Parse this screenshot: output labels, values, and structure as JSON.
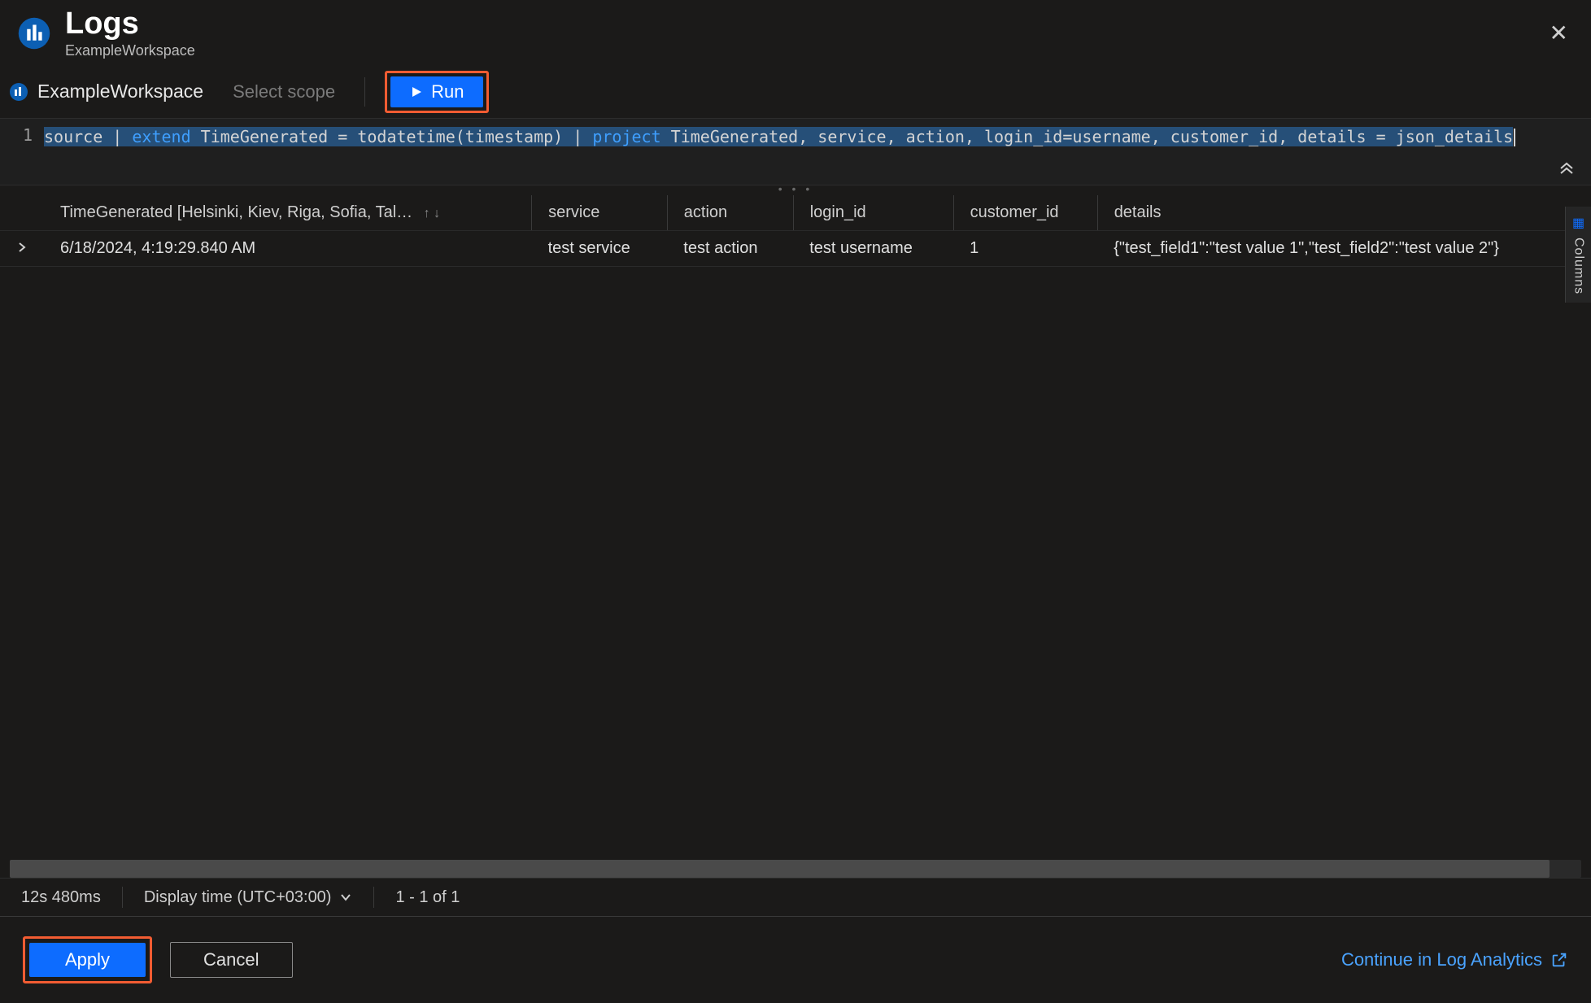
{
  "header": {
    "title": "Logs",
    "subtitle": "ExampleWorkspace"
  },
  "toolbar": {
    "workspace_name": "ExampleWorkspace",
    "select_scope_label": "Select scope",
    "run_label": "Run"
  },
  "editor": {
    "line_number": "1",
    "query_tokens": [
      {
        "t": "source ",
        "c": "tkn",
        "sel": true
      },
      {
        "t": "| ",
        "c": "tkn",
        "sel": true
      },
      {
        "t": "extend",
        "c": "kw",
        "sel": true
      },
      {
        "t": " TimeGenerated = todatetime(timestamp) ",
        "c": "tkn",
        "sel": true
      },
      {
        "t": "| ",
        "c": "tkn",
        "sel": true
      },
      {
        "t": "project",
        "c": "kw",
        "sel": true
      },
      {
        "t": " TimeGenerated, service, action, login_id=username, customer_id, details = json_details",
        "c": "tkn",
        "sel": true
      }
    ]
  },
  "results": {
    "columns_tab_label": "Columns",
    "headers": [
      {
        "label": "TimeGenerated [Helsinki, Kiev, Riga, Sofia, Tal…",
        "sortable": true
      },
      {
        "label": "service",
        "sortable": false
      },
      {
        "label": "action",
        "sortable": false
      },
      {
        "label": "login_id",
        "sortable": false
      },
      {
        "label": "customer_id",
        "sortable": false
      },
      {
        "label": "details",
        "sortable": false
      }
    ],
    "rows": [
      {
        "TimeGenerated": "6/18/2024, 4:19:29.840 AM",
        "service": "test service",
        "action": "test action",
        "login_id": "test username",
        "customer_id": "1",
        "details": "{\"test_field1\":\"test value 1\",\"test_field2\":\"test value 2\"}"
      }
    ]
  },
  "statusbar": {
    "timing": "12s 480ms",
    "display_time_label": "Display time (UTC+03:00)",
    "pager": "1 - 1 of 1"
  },
  "footer": {
    "apply_label": "Apply",
    "cancel_label": "Cancel",
    "continue_label": "Continue in Log Analytics"
  }
}
